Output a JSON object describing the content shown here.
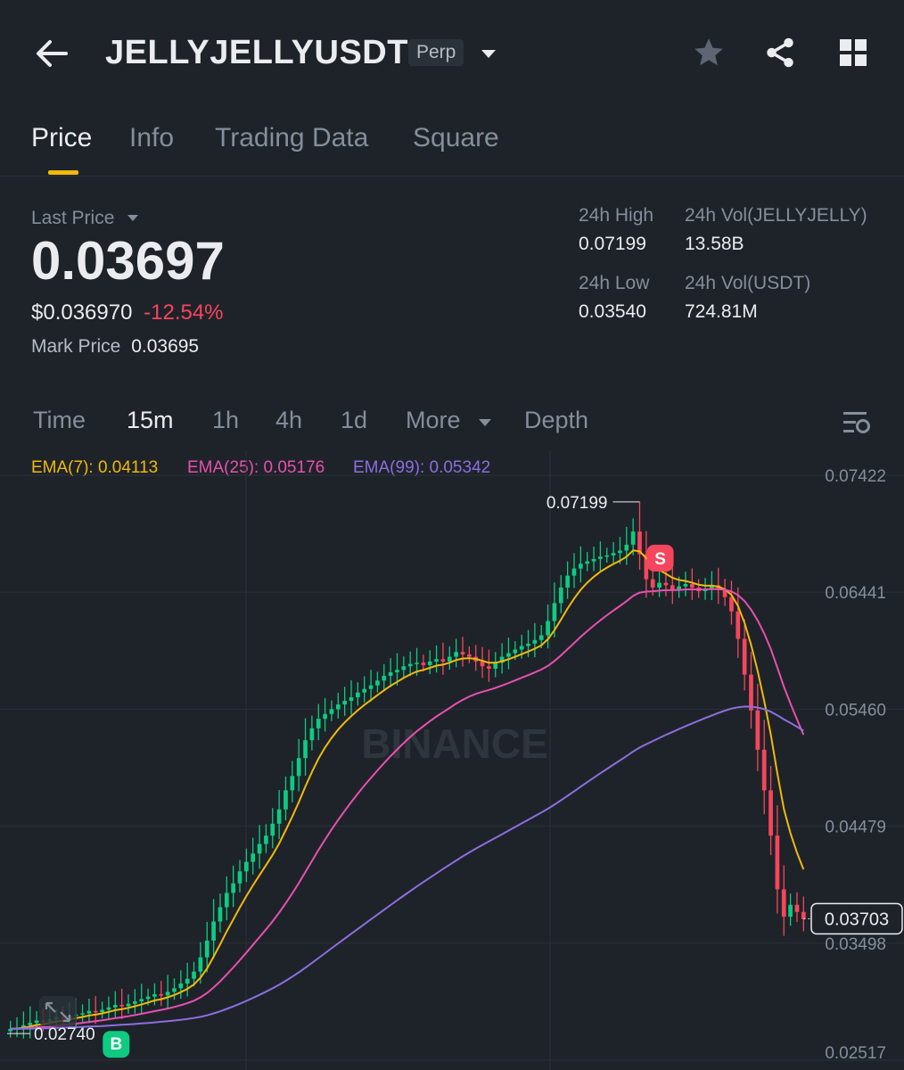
{
  "header": {
    "symbol": "JELLYJELLYUSDT",
    "contract_type": "Perp",
    "icons": [
      "back-arrow-icon",
      "dropdown-caret-icon",
      "star-icon",
      "share-icon",
      "grid-menu-icon"
    ]
  },
  "tabs": [
    {
      "label": "Price",
      "active": true
    },
    {
      "label": "Info",
      "active": false
    },
    {
      "label": "Trading Data",
      "active": false
    },
    {
      "label": "Square",
      "active": false
    }
  ],
  "ticker": {
    "last_price_label": "Last Price",
    "last_price": "0.03697",
    "usd_price": "$0.036970",
    "change_pct": "-12.54%",
    "mark_price_label": "Mark Price",
    "mark_price": "0.03695",
    "high_label": "24h High",
    "high": "0.07199",
    "low_label": "24h Low",
    "low": "0.03540",
    "vol_base_label": "24h Vol(JELLYJELLY)",
    "vol_base": "13.58B",
    "vol_quote_label": "24h Vol(USDT)",
    "vol_quote": "724.81M"
  },
  "intervals": [
    "Time",
    "15m",
    "1h",
    "4h",
    "1d",
    "More",
    "Depth"
  ],
  "selected_interval": "15m",
  "colors": {
    "up": "#0ecb81",
    "down": "#f6465d",
    "ema7": "#f0b90b",
    "ema25": "#e84fb0",
    "ema99": "#8c6ee0",
    "accent": "#f0b90b"
  },
  "chart_data": {
    "type": "candlestick",
    "y_ticks": [
      "0.07422",
      "0.06441",
      "0.05460",
      "0.04479",
      "0.03498",
      "0.02517"
    ],
    "ylim": [
      0.02517,
      0.07422
    ],
    "current_price": "0.03703",
    "high_marker": "0.07199",
    "low_marker": "0.02740",
    "watermark": "BINANCE",
    "markers": {
      "sell": "S",
      "buy": "B"
    },
    "ema_labels": {
      "ema7": "EMA(7): 0.04113",
      "ema25": "EMA(25): 0.05176",
      "ema99": "EMA(99): 0.05342"
    },
    "closes": [
      0.0278,
      0.0279,
      0.0281,
      0.0283,
      0.0285,
      0.0284,
      0.0286,
      0.0288,
      0.0287,
      0.0289,
      0.029,
      0.0291,
      0.0293,
      0.0292,
      0.0294,
      0.0296,
      0.0298,
      0.0297,
      0.0299,
      0.0301,
      0.0303,
      0.0305,
      0.0307,
      0.0306,
      0.0309,
      0.0312,
      0.0316,
      0.032,
      0.0326,
      0.0338,
      0.0352,
      0.0368,
      0.038,
      0.0392,
      0.04,
      0.041,
      0.0418,
      0.0425,
      0.0433,
      0.044,
      0.045,
      0.0462,
      0.0478,
      0.049,
      0.0505,
      0.052,
      0.053,
      0.0538,
      0.0542,
      0.0546,
      0.055,
      0.0553,
      0.0556,
      0.056,
      0.0563,
      0.0566,
      0.057,
      0.0574,
      0.0577,
      0.0579,
      0.0582,
      0.0584,
      0.0585,
      0.0583,
      0.0586,
      0.0588,
      0.0586,
      0.059,
      0.0594,
      0.0592,
      0.059,
      0.0586,
      0.0582,
      0.058,
      0.0585,
      0.059,
      0.0593,
      0.0596,
      0.0599,
      0.0601,
      0.0604,
      0.0608,
      0.062,
      0.0635,
      0.0648,
      0.0658,
      0.0664,
      0.0668,
      0.067,
      0.0672,
      0.0674,
      0.0675,
      0.0677,
      0.0679,
      0.0684,
      0.0695,
      0.0676,
      0.0655,
      0.0648,
      0.0652,
      0.065,
      0.0646,
      0.0649,
      0.0651,
      0.0648,
      0.0645,
      0.0647,
      0.065,
      0.0646,
      0.064,
      0.0628,
      0.0605,
      0.0575,
      0.0545,
      0.0512,
      0.0478,
      0.044,
      0.0395,
      0.0372,
      0.0382,
      0.0376,
      0.037
    ]
  }
}
